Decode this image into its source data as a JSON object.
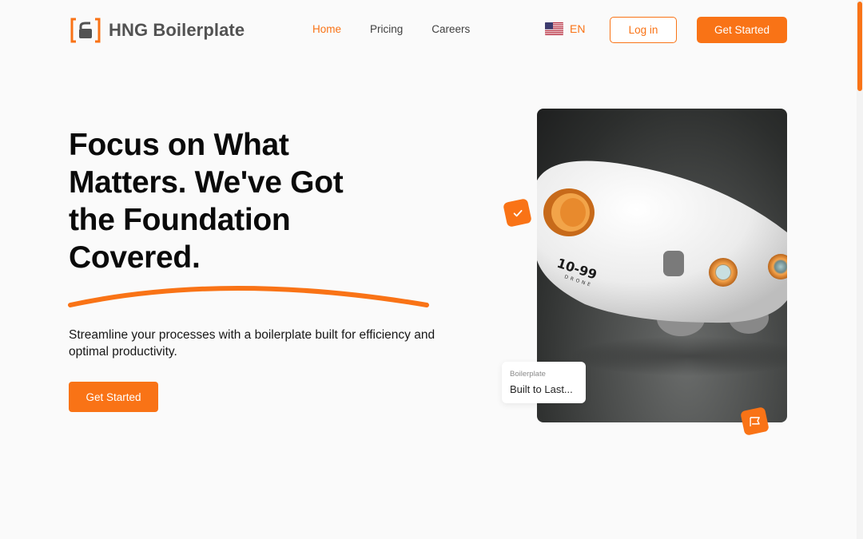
{
  "brand": {
    "name": "HNG Boilerplate",
    "accent": "#f97316"
  },
  "nav": {
    "links": [
      {
        "label": "Home",
        "active": true
      },
      {
        "label": "Pricing",
        "active": false
      },
      {
        "label": "Careers",
        "active": false
      }
    ],
    "language": "EN",
    "login_label": "Log in",
    "get_started_label": "Get Started"
  },
  "hero": {
    "headline_lines": [
      "Focus on What",
      "Matters. We've Got",
      "the Foundation",
      "Covered."
    ],
    "subtitle": "Streamline your processes with a boilerplate built for efficiency and optimal productivity.",
    "cta_label": "Get Started"
  },
  "image_card": {
    "small_label": "Boilerplate",
    "main_label": "Built to Last..."
  },
  "product_print": {
    "model": "10-99",
    "sub": "DRONE"
  },
  "icons": [
    "logo-mark",
    "us-flag-icon",
    "check-icon",
    "flag-icon"
  ]
}
